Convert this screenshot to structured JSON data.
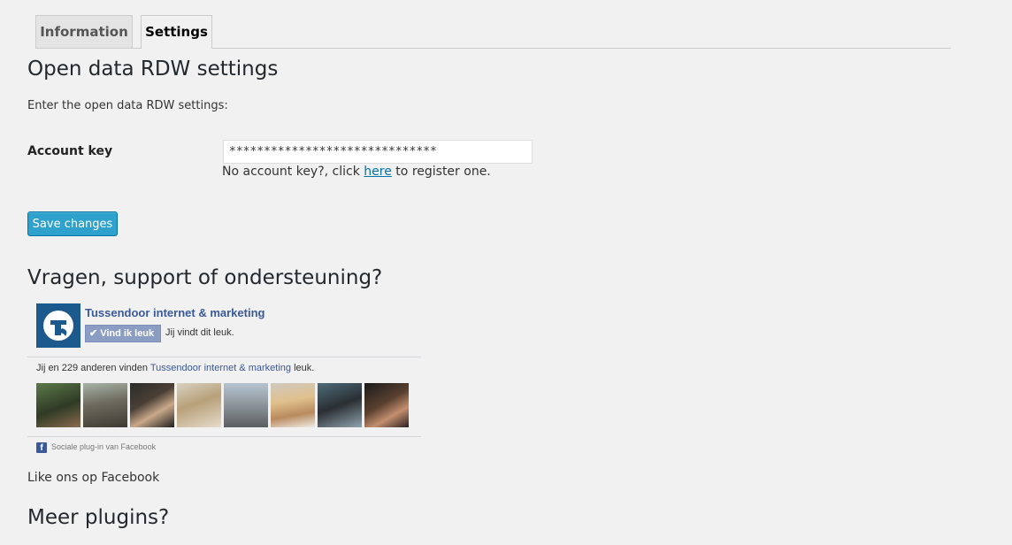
{
  "tabs": [
    {
      "label": "Information"
    },
    {
      "label": "Settings"
    }
  ],
  "settings": {
    "heading": "Open data RDW settings",
    "intro": "Enter the open data RDW settings:",
    "account_label": "Account key",
    "account_value": "******************************",
    "hint_prefix": "No account key?, click ",
    "hint_link": "here",
    "hint_suffix": " to register one.",
    "save_label": "Save changes"
  },
  "support": {
    "heading": "Vragen, support of ondersteuning?"
  },
  "facebook": {
    "page_name": "Tussendoor internet & marketing",
    "like_button": "Vind ik leuk",
    "you_like": "Jij vindt dit leuk.",
    "count_prefix": "Jij en 229 anderen vinden ",
    "count_link": "Tussendoor internet & marketing",
    "count_suffix": " leuk.",
    "footer": "Sociale plug-in van Facebook",
    "colors": {
      "brand": "#3b5998",
      "logo": "#1c5a8e"
    }
  },
  "like_us": "Like ons op Facebook",
  "more": {
    "heading": "Meer plugins?"
  },
  "colors": {
    "primary_button": "#2ea2cc",
    "link": "#0073aa",
    "background": "#f1f1f1"
  }
}
